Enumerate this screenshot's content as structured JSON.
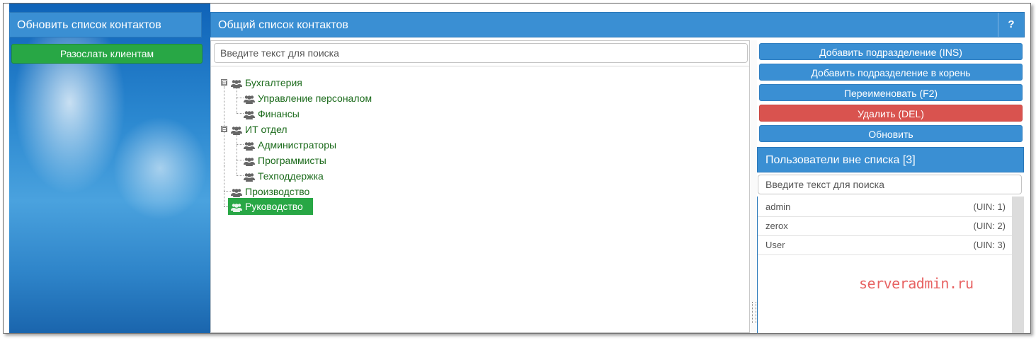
{
  "left": {
    "header_title": "Обновить список контактов",
    "send_button": "Разослать клиентам"
  },
  "main": {
    "header_title": "Общий список контактов",
    "help_label": "?",
    "search_placeholder": "Введите текст для поиска",
    "tree": {
      "buhgalteriya": "Бухгалтерия",
      "upravlenie": "Управление персоналом",
      "finansy": "Финансы",
      "it_otdel": "ИТ отдел",
      "admins": "Администраторы",
      "programmisty": "Программисты",
      "tehpodderzhka": "Техподдержка",
      "proizvodstvo": "Производство",
      "rukovodstvo": "Руководство",
      "toggle_symbol": "⊟"
    }
  },
  "actions": {
    "add_sub": "Добавить подразделение (INS)",
    "add_root": "Добавить подразделение в корень",
    "rename": "Переименовать (F2)",
    "delete": "Удалить (DEL)",
    "refresh": "Обновить"
  },
  "users": {
    "header_title": "Пользователи вне списка [3]",
    "search_placeholder": "Введите текст для поиска",
    "rows": [
      {
        "name": "admin",
        "uin": "(UIN: 1)"
      },
      {
        "name": "zerox",
        "uin": "(UIN: 2)"
      },
      {
        "name": "User",
        "uin": "(UIN: 3)"
      }
    ]
  },
  "watermark": "serveradmin.ru",
  "colors": {
    "header_blue": "#3a8fd3",
    "green": "#28a745",
    "red": "#d9534f",
    "tree_text": "#1c6b1c"
  }
}
